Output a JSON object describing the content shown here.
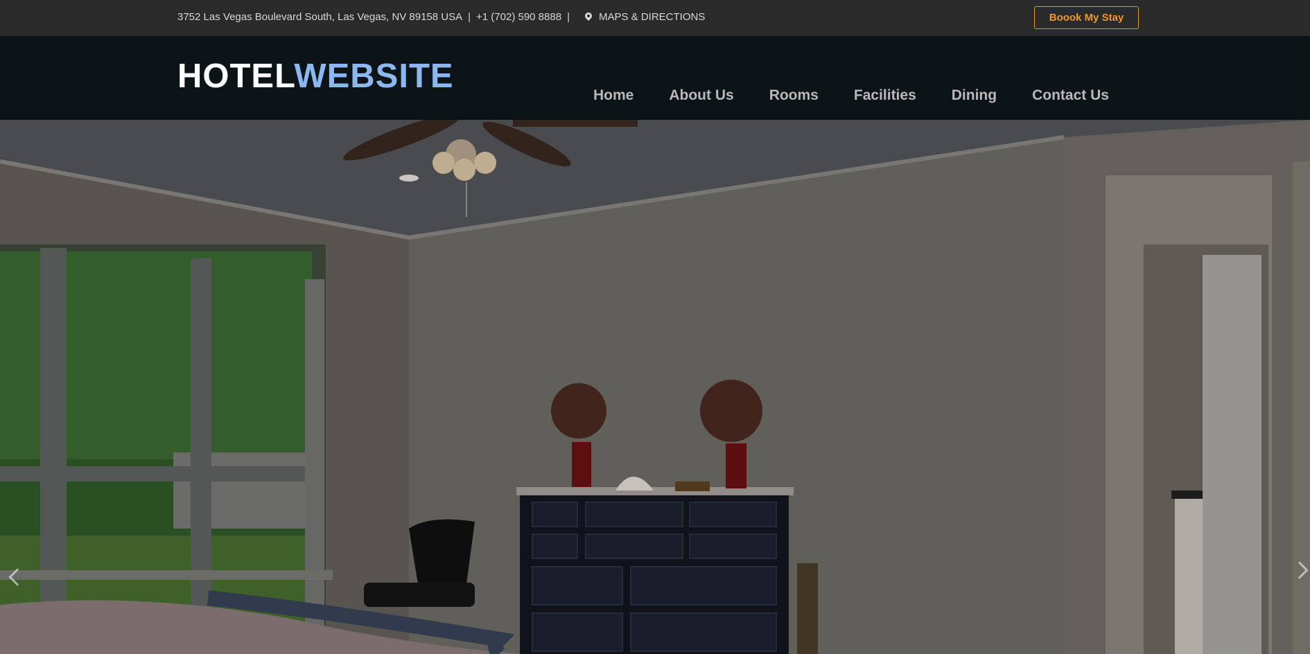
{
  "topbar": {
    "address": "3752 Las Vegas Boulevard South, Las Vegas, NV 89158 USA",
    "separator": "|",
    "phone": "+1 (702) 590 8888",
    "maps_label": "MAPS & DIRECTIONS",
    "book_label": "Boook My Stay"
  },
  "header": {
    "logo_part1": "HOTEL",
    "logo_part2": "WEBSITE",
    "nav": [
      {
        "label": "Home"
      },
      {
        "label": "About Us"
      },
      {
        "label": "Rooms"
      },
      {
        "label": "Facilities"
      },
      {
        "label": "Dining"
      },
      {
        "label": "Contact Us"
      }
    ]
  },
  "colors": {
    "accent_orange": "#e8952a",
    "logo_blue": "#8cb8f2",
    "header_bg": "#0d1418",
    "topbar_bg": "#2a2a2a"
  },
  "hero": {
    "icons": [
      "slider-prev-icon",
      "slider-next-icon"
    ]
  }
}
